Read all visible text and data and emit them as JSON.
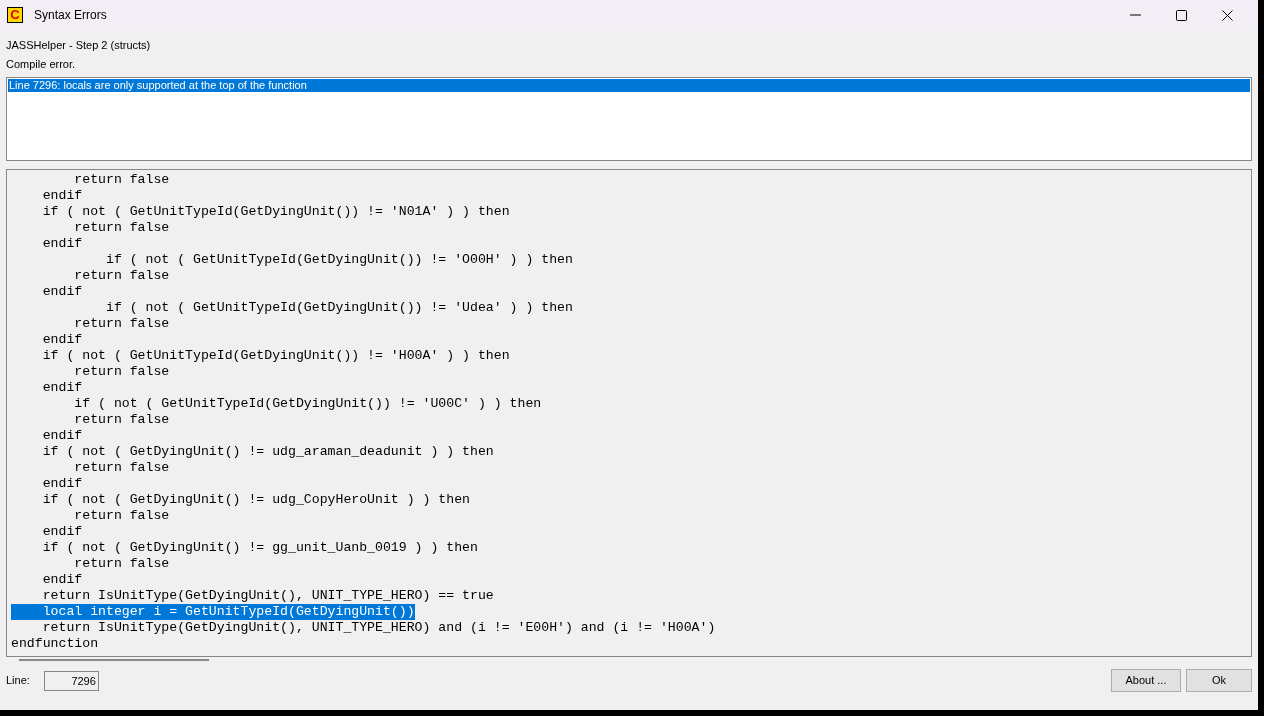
{
  "window": {
    "title": "Syntax Errors",
    "app_icon_letter": "C"
  },
  "header": [
    "JASSHelper - Step 2 (structs)",
    "Compile error."
  ],
  "errors": [
    {
      "text": "Line 7296: locals are only supported at the top of the function",
      "selected": true
    }
  ],
  "code_lines": [
    {
      "text": "        return false",
      "selected": false
    },
    {
      "text": "    endif",
      "selected": false
    },
    {
      "text": "    if ( not ( GetUnitTypeId(GetDyingUnit()) != 'N01A' ) ) then",
      "selected": false
    },
    {
      "text": "        return false",
      "selected": false
    },
    {
      "text": "    endif",
      "selected": false
    },
    {
      "text": "            if ( not ( GetUnitTypeId(GetDyingUnit()) != 'O00H' ) ) then",
      "selected": false
    },
    {
      "text": "        return false",
      "selected": false
    },
    {
      "text": "    endif",
      "selected": false
    },
    {
      "text": "            if ( not ( GetUnitTypeId(GetDyingUnit()) != 'Udea' ) ) then",
      "selected": false
    },
    {
      "text": "        return false",
      "selected": false
    },
    {
      "text": "    endif",
      "selected": false
    },
    {
      "text": "    if ( not ( GetUnitTypeId(GetDyingUnit()) != 'H00A' ) ) then",
      "selected": false
    },
    {
      "text": "        return false",
      "selected": false
    },
    {
      "text": "    endif",
      "selected": false
    },
    {
      "text": "        if ( not ( GetUnitTypeId(GetDyingUnit()) != 'U00C' ) ) then",
      "selected": false
    },
    {
      "text": "        return false",
      "selected": false
    },
    {
      "text": "    endif",
      "selected": false
    },
    {
      "text": "    if ( not ( GetDyingUnit() != udg_araman_deadunit ) ) then",
      "selected": false
    },
    {
      "text": "        return false",
      "selected": false
    },
    {
      "text": "    endif",
      "selected": false
    },
    {
      "text": "    if ( not ( GetDyingUnit() != udg_CopyHeroUnit ) ) then",
      "selected": false
    },
    {
      "text": "        return false",
      "selected": false
    },
    {
      "text": "    endif",
      "selected": false
    },
    {
      "text": "    if ( not ( GetDyingUnit() != gg_unit_Uanb_0019 ) ) then",
      "selected": false
    },
    {
      "text": "        return false",
      "selected": false
    },
    {
      "text": "    endif",
      "selected": false
    },
    {
      "text": "    return IsUnitType(GetDyingUnit(), UNIT_TYPE_HERO) == true",
      "selected": false
    },
    {
      "text": "    local integer i = GetUnitTypeId(GetDyingUnit())",
      "selected": true
    },
    {
      "text": "    return IsUnitType(GetDyingUnit(), UNIT_TYPE_HERO) and (i != 'E00H') and (i != 'H00A')",
      "selected": false
    },
    {
      "text": "endfunction",
      "selected": false
    }
  ],
  "line_field": {
    "label": "Line:",
    "value": "7296"
  },
  "buttons": [
    {
      "label": "About ..."
    },
    {
      "label": "Ok"
    }
  ]
}
